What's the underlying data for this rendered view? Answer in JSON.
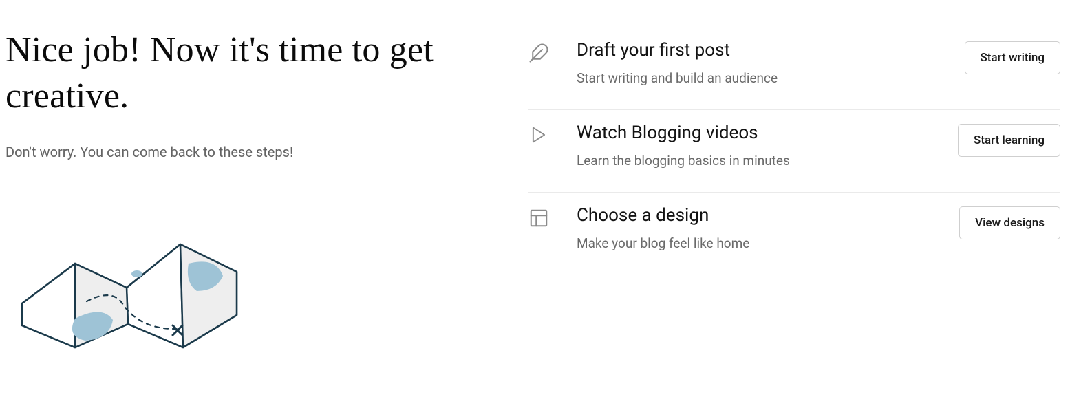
{
  "hero": {
    "headline": "Nice job! Now it's time to get creative.",
    "subhead": "Don't worry. You can come back to these steps!"
  },
  "steps": [
    {
      "icon": "feather-icon",
      "title": "Draft your first post",
      "desc": "Start writing and build an audience",
      "action": "Start writing"
    },
    {
      "icon": "play-icon",
      "title": "Watch Blogging videos",
      "desc": "Learn the blogging basics in minutes",
      "action": "Start learning"
    },
    {
      "icon": "layout-icon",
      "title": "Choose a design",
      "desc": "Make your blog feel like home",
      "action": "View designs"
    }
  ]
}
